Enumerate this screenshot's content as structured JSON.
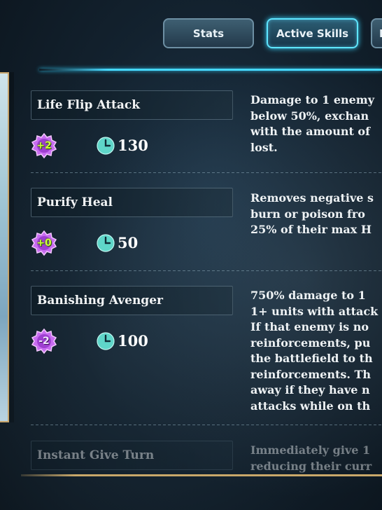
{
  "tabs": {
    "stats": "Stats",
    "active_skills": "Active Skills",
    "third_partial": "P"
  },
  "skills": [
    {
      "name": "Life Flip Attack",
      "cost": "+2",
      "cost_type": "positive",
      "cooldown": "130",
      "description": [
        "Damage to 1 enemy",
        "below 50%, exchan",
        "with the amount of",
        "lost."
      ]
    },
    {
      "name": "Purify Heal",
      "cost": "+0",
      "cost_type": "positive",
      "cooldown": "50",
      "description": [
        "Removes negative s",
        "burn or poison fro",
        "25% of their max H"
      ]
    },
    {
      "name": "Banishing Avenger",
      "cost": "-2",
      "cost_type": "negative",
      "cooldown": "100",
      "description": [
        "750% damage to 1",
        "1+ units with attack",
        "If that enemy is no",
        "reinforcements, pu",
        "the battlefield to th",
        "reinforcements. Th",
        "away if they have n",
        "attacks while on th"
      ]
    },
    {
      "name": "Instant Give Turn",
      "description": [
        "Immediately give 1",
        "reducing their curr"
      ]
    }
  ],
  "icons": {
    "cost_badge": "gear-badge-icon",
    "cooldown": "clock-icon"
  },
  "colors": {
    "active_tab_glow": "#5fe6ff",
    "positive_cost": "#cfff3a",
    "badge_fill": "#c86cf0",
    "clock_fill": "#5fd6c9"
  }
}
